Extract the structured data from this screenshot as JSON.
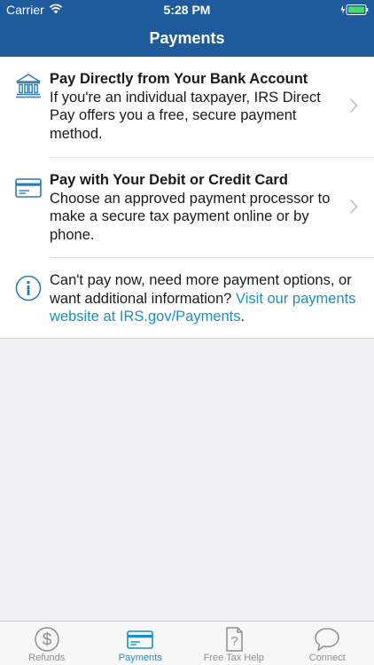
{
  "status": {
    "carrier": "Carrier",
    "time": "5:28 PM"
  },
  "header": {
    "title": "Payments"
  },
  "items": [
    {
      "icon": "bank-icon",
      "title": "Pay Directly from Your Bank Account",
      "description": "If you're an individual taxpayer, IRS Direct Pay offers you a free, secure payment method."
    },
    {
      "icon": "credit-card-icon",
      "title": "Pay with Your Debit or Credit Card",
      "description": "Choose an approved payment processor to make a secure tax payment online or by phone."
    }
  ],
  "info": {
    "icon": "info-icon",
    "text": "Can't pay now, need more payment options, or want additional information? ",
    "link_text": "Visit our payments website at IRS.gov/Payments",
    "suffix": "."
  },
  "tabs": [
    {
      "label": "Refunds",
      "icon": "dollar-icon",
      "active": false
    },
    {
      "label": "Payments",
      "icon": "card-icon",
      "active": true
    },
    {
      "label": "Free Tax Help",
      "icon": "question-icon",
      "active": false
    },
    {
      "label": "Connect",
      "icon": "chat-bubble-icon",
      "active": false
    }
  ],
  "colors": {
    "header": "#1f5b9c",
    "accent": "#1a8fc4",
    "tab_inactive": "#8e8e93"
  }
}
